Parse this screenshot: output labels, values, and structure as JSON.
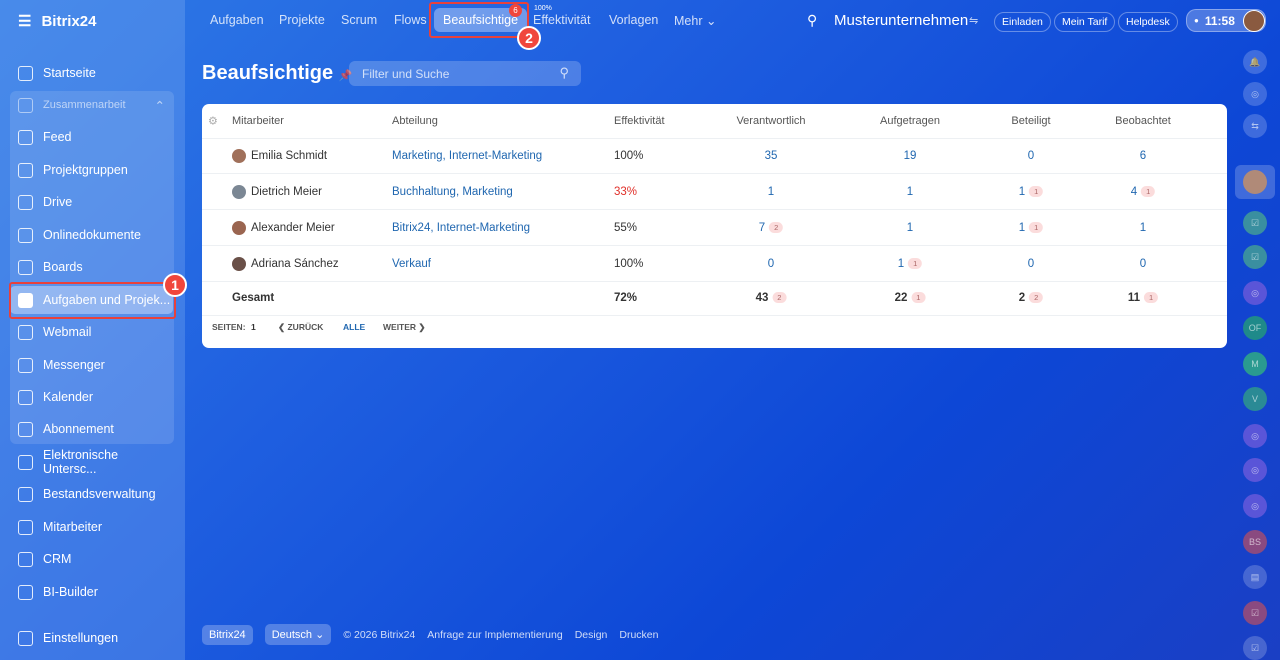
{
  "app": {
    "logo": "Bitrix24"
  },
  "sidebar": {
    "group_title": "Zusammenarbeit",
    "items": [
      {
        "label": "Startseite",
        "icon": "home-icon"
      },
      {
        "label": "Feed",
        "icon": "feed-icon"
      },
      {
        "label": "Projektgruppen",
        "icon": "groups-icon"
      },
      {
        "label": "Drive",
        "icon": "drive-icon"
      },
      {
        "label": "Onlinedokumente",
        "icon": "document-icon"
      },
      {
        "label": "Boards",
        "icon": "boards-icon"
      },
      {
        "label": "Aufgaben und Projek...",
        "icon": "check-icon"
      },
      {
        "label": "Webmail",
        "icon": "mail-icon"
      },
      {
        "label": "Messenger",
        "icon": "chat-icon"
      },
      {
        "label": "Kalender",
        "icon": "calendar-icon"
      },
      {
        "label": "Abonnement",
        "icon": "subscription-icon"
      },
      {
        "label": "Elektronische Untersc...",
        "icon": "signature-icon"
      },
      {
        "label": "Bestandsverwaltung",
        "icon": "inventory-icon"
      },
      {
        "label": "Mitarbeiter",
        "icon": "employees-icon"
      },
      {
        "label": "CRM",
        "icon": "crm-icon"
      },
      {
        "label": "BI-Builder",
        "icon": "chart-icon"
      },
      {
        "label": "Einstellungen",
        "icon": "gear-icon"
      }
    ]
  },
  "topnav": {
    "tabs": [
      "Aufgaben",
      "Projekte",
      "Scrum",
      "Flows",
      "Beaufsichtige",
      "Effektivität",
      "Vorlagen",
      "Mehr"
    ],
    "active_badge": "6",
    "effectivity_label": "100%",
    "company": "Musterunternehmen",
    "invite": "Einladen",
    "plan": "Mein Tarif",
    "helpdesk": "Helpdesk",
    "time": "11:58"
  },
  "annotations": [
    "1",
    "2"
  ],
  "page": {
    "title": "Beaufsichtige",
    "search_placeholder": "Filter und Suche"
  },
  "table": {
    "headers": [
      "Mitarbeiter",
      "Abteilung",
      "Effektivität",
      "Verantwortlich",
      "Aufgetragen",
      "Beteiligt",
      "Beobachtet"
    ],
    "rows": [
      {
        "name": "Emilia Schmidt",
        "dept": "Marketing, Internet-Marketing",
        "eff": "100%",
        "v": "35",
        "vb": "",
        "a": "19",
        "ab": "",
        "b": "0",
        "bb": "",
        "o": "6",
        "ob": ""
      },
      {
        "name": "Dietrich Meier",
        "dept": "Buchhaltung, Marketing",
        "eff": "33%",
        "v": "1",
        "vb": "",
        "a": "1",
        "ab": "",
        "b": "1",
        "bb": "1",
        "o": "4",
        "ob": "1"
      },
      {
        "name": "Alexander Meier",
        "dept": "Bitrix24, Internet-Marketing",
        "eff": "55%",
        "v": "7",
        "vb": "2",
        "a": "1",
        "ab": "",
        "b": "1",
        "bb": "1",
        "o": "1",
        "ob": ""
      },
      {
        "name": "Adriana Sánchez",
        "dept": "Verkauf",
        "eff": "100%",
        "v": "0",
        "vb": "",
        "a": "1",
        "ab": "1",
        "b": "0",
        "bb": "",
        "o": "0",
        "ob": ""
      }
    ],
    "total": {
      "name": "Gesamt",
      "eff": "72%",
      "v": "43",
      "vb": "2",
      "a": "22",
      "ab": "1",
      "b": "2",
      "bb": "2",
      "o": "11",
      "ob": "1"
    },
    "pager": {
      "pages_label": "SEITEN:",
      "page": "1",
      "prev": "ZURÜCK",
      "all": "ALLE",
      "next": "WEITER"
    }
  },
  "rail": [
    "OF",
    "M",
    "V",
    "BS"
  ],
  "footer": {
    "brand": "Bitrix24",
    "language": "Deutsch",
    "copyright": "© 2026 Bitrix24",
    "impl": "Anfrage zur Implementierung",
    "design": "Design",
    "print": "Drucken"
  },
  "colors": {
    "link": "#2067b0",
    "negative": "#e0302a",
    "highlight": "#e8413b"
  }
}
